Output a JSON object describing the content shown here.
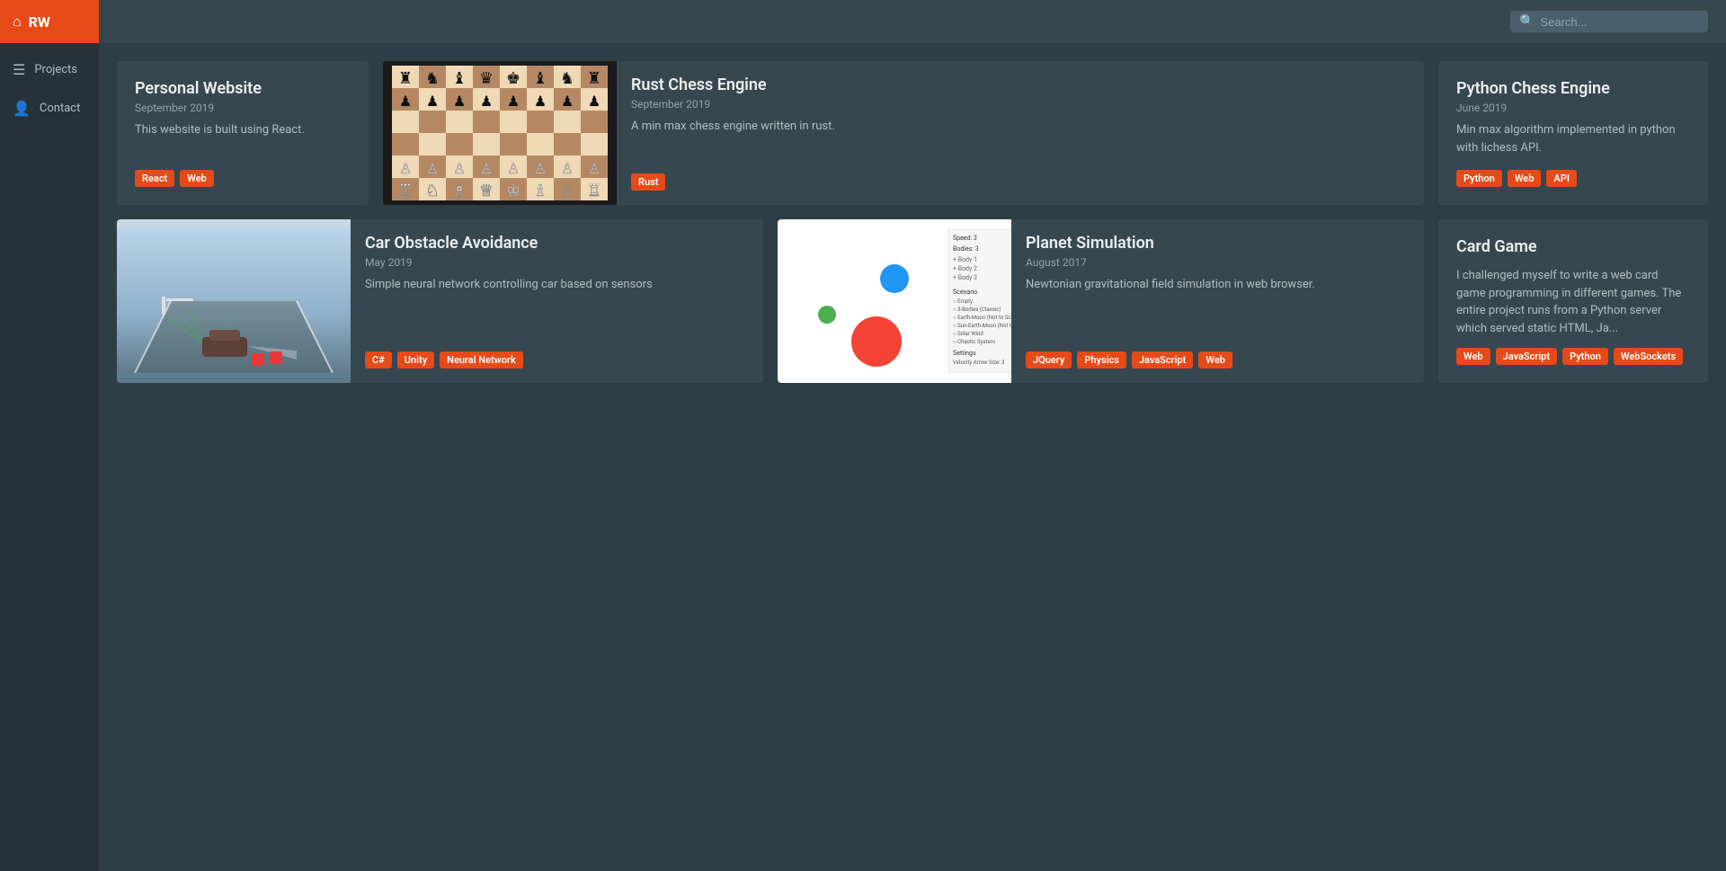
{
  "sidebar": {
    "logo": "RW",
    "home_icon": "⌂",
    "nav": [
      {
        "id": "projects",
        "label": "Projects",
        "icon": "☰"
      },
      {
        "id": "contact",
        "label": "Contact",
        "icon": "👤"
      }
    ]
  },
  "header": {
    "search_placeholder": "Search..."
  },
  "projects_row1": [
    {
      "id": "personal-website",
      "title": "Personal Website",
      "date": "September 2019",
      "description": "This website is built using React.",
      "tags": [
        "React",
        "Web"
      ],
      "has_image": false
    },
    {
      "id": "rust-chess-engine",
      "title": "Rust Chess Engine",
      "date": "September 2019",
      "description": "A min max chess engine written in rust.",
      "tags": [
        "Rust"
      ],
      "has_image": true,
      "image_type": "chess"
    },
    {
      "id": "python-chess-engine",
      "title": "Python Chess Engine",
      "date": "June 2019",
      "description": "Min max algorithm implemented in python with lichess API.",
      "tags": [
        "Python",
        "Web",
        "API"
      ],
      "has_image": false
    }
  ],
  "projects_row2": [
    {
      "id": "car-obstacle-avoidance",
      "title": "Car Obstacle Avoidance",
      "date": "May 2019",
      "description": "Simple neural network controlling car based on sensors",
      "tags": [
        "C#",
        "Unity",
        "Neural Network"
      ],
      "has_image": true,
      "image_type": "car"
    },
    {
      "id": "planet-simulation",
      "title": "Planet Simulation",
      "date": "August 2017",
      "description": "Newtonian gravitational field simulation in web browser.",
      "tags": [
        "JQuery",
        "Physics",
        "JavaScript",
        "Web"
      ],
      "has_image": true,
      "image_type": "planet"
    },
    {
      "id": "card-game",
      "title": "Card Game",
      "date": "",
      "description": "I challenged myself to write a web card game programming in different games. The entire project runs from a Python server which served static HTML, Ja...",
      "tags": [
        "Web",
        "JavaScript",
        "Python",
        "WebSockets"
      ],
      "has_image": false
    }
  ]
}
